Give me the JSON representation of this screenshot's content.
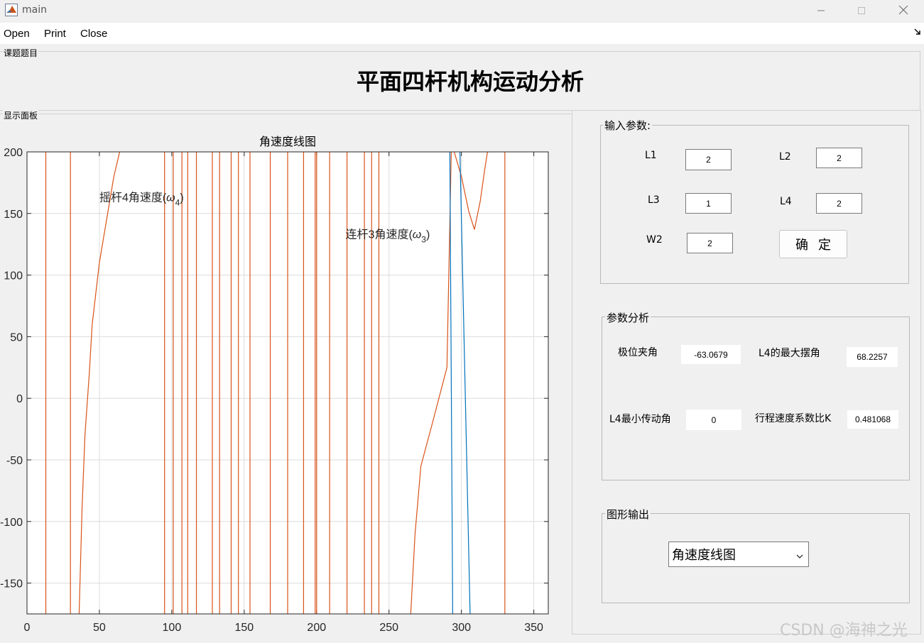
{
  "window": {
    "title": "main",
    "minimize_icon": "minimize-icon",
    "maximize_icon": "maximize-icon",
    "close_icon": "close-icon"
  },
  "menu": {
    "items": [
      "Open",
      "Print",
      "Close"
    ],
    "overflow_icon": "corner-arrow-icon"
  },
  "title_panel": {
    "legend": "课题题目",
    "title": "平面四杆机构运动分析"
  },
  "display_panel": {
    "legend": "显示面板"
  },
  "input_panel": {
    "legend": "输入参数:",
    "L1": {
      "label": "L1",
      "value": "2"
    },
    "L2": {
      "label": "L2",
      "value": "2"
    },
    "L3": {
      "label": "L3",
      "value": "1"
    },
    "L4": {
      "label": "L4",
      "value": "2"
    },
    "W2": {
      "label": "W2",
      "value": "2"
    },
    "confirm": "确定"
  },
  "analysis_panel": {
    "legend": "参数分析",
    "extreme_angle": {
      "label": "极位夹角",
      "value": "-63.0679"
    },
    "max_swing": {
      "label": "L4的最大摆角",
      "value": "68.2257"
    },
    "min_transmission": {
      "label": "L4最小传动角",
      "value": "0"
    },
    "speed_ratio": {
      "label": "行程速度系数比K",
      "value": "0.481068"
    }
  },
  "output_panel": {
    "legend": "图形输出",
    "selected": "角速度线图",
    "dropdown_icon": "chevron-down-icon"
  },
  "watermark": "CSDN @海神之光",
  "chart_data": {
    "type": "line",
    "title": "角速度线图",
    "xlabel": "",
    "ylabel": "",
    "xlim": [
      0,
      360
    ],
    "ylim": [
      -175,
      200
    ],
    "xticks": [
      0,
      50,
      100,
      150,
      200,
      250,
      300,
      350
    ],
    "yticks": [
      -150,
      -100,
      -50,
      0,
      50,
      100,
      150,
      200
    ],
    "grid": true,
    "colors": {
      "orange": "#d95319",
      "blue": "#0072bd"
    },
    "vertical_lines_orange": [
      13,
      30,
      95,
      101,
      107,
      111,
      117,
      128,
      133,
      141,
      146,
      154,
      168,
      180,
      191,
      199,
      200,
      209,
      221,
      233,
      238,
      243,
      330
    ],
    "series": [
      {
        "points": [
          [
            36,
            -175
          ],
          [
            38,
            -90
          ],
          [
            40,
            -30
          ],
          [
            43,
            20
          ],
          [
            45,
            60
          ],
          [
            50,
            110
          ],
          [
            55,
            145
          ],
          [
            60,
            180
          ],
          [
            64,
            200
          ]
        ]
      },
      {
        "points": [
          [
            265,
            -175
          ],
          [
            268,
            -110
          ],
          [
            272,
            -55
          ],
          [
            280,
            -20
          ],
          [
            290,
            25
          ],
          [
            293,
            200
          ]
        ]
      },
      {
        "points": [
          [
            295,
            200
          ],
          [
            300,
            180
          ],
          [
            305,
            152
          ],
          [
            309,
            137
          ],
          [
            313,
            160
          ],
          [
            316,
            185
          ],
          [
            318,
            200
          ]
        ]
      },
      {
        "color": "blue",
        "points": [
          [
            292,
            200
          ],
          [
            294,
            -175
          ]
        ]
      },
      {
        "color": "blue",
        "points": [
          [
            299,
            200
          ],
          [
            306,
            -175
          ]
        ]
      }
    ],
    "annotations": [
      {
        "text": "摇杆4角速度(ω4)",
        "x": 50,
        "y": 160
      },
      {
        "text": "连杆3角速度(ω3)",
        "x": 220,
        "y": 130
      }
    ]
  }
}
